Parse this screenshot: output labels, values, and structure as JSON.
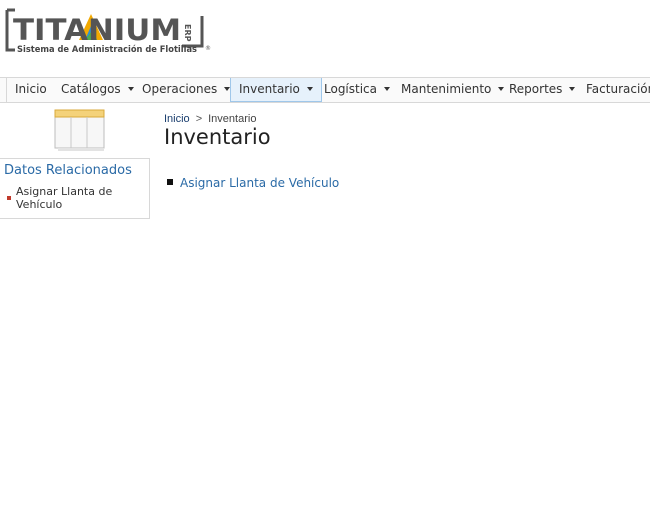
{
  "logo": {
    "brand": "TITANIUM",
    "suffix": "ERP",
    "tagline": "Sistema de Administración de Flotillas",
    "registered": "®"
  },
  "nav": {
    "items": [
      {
        "label": "Inicio",
        "dropdown": false
      },
      {
        "label": "Catálogos",
        "dropdown": true
      },
      {
        "label": "Operaciones",
        "dropdown": true
      },
      {
        "label": "Inventario",
        "dropdown": true,
        "active": true
      },
      {
        "label": "Logística",
        "dropdown": true
      },
      {
        "label": "Mantenimiento",
        "dropdown": true
      },
      {
        "label": "Reportes",
        "dropdown": true
      },
      {
        "label": "Facturación",
        "dropdown": false
      }
    ]
  },
  "sidebar": {
    "icon": "table-icon",
    "title": "Datos Relacionados",
    "links": [
      "Asignar Llanta de Vehículo"
    ]
  },
  "breadcrumb": {
    "home": "Inicio",
    "separator": ">",
    "current": "Inventario"
  },
  "main": {
    "title": "Inventario",
    "links": [
      "Asignar Llanta de Vehículo"
    ]
  },
  "colors": {
    "link": "#2a6aa6",
    "active_tab_bg": "#e6f1fb",
    "active_tab_border": "#9fc7ea",
    "bullet_red": "#c0392b"
  }
}
